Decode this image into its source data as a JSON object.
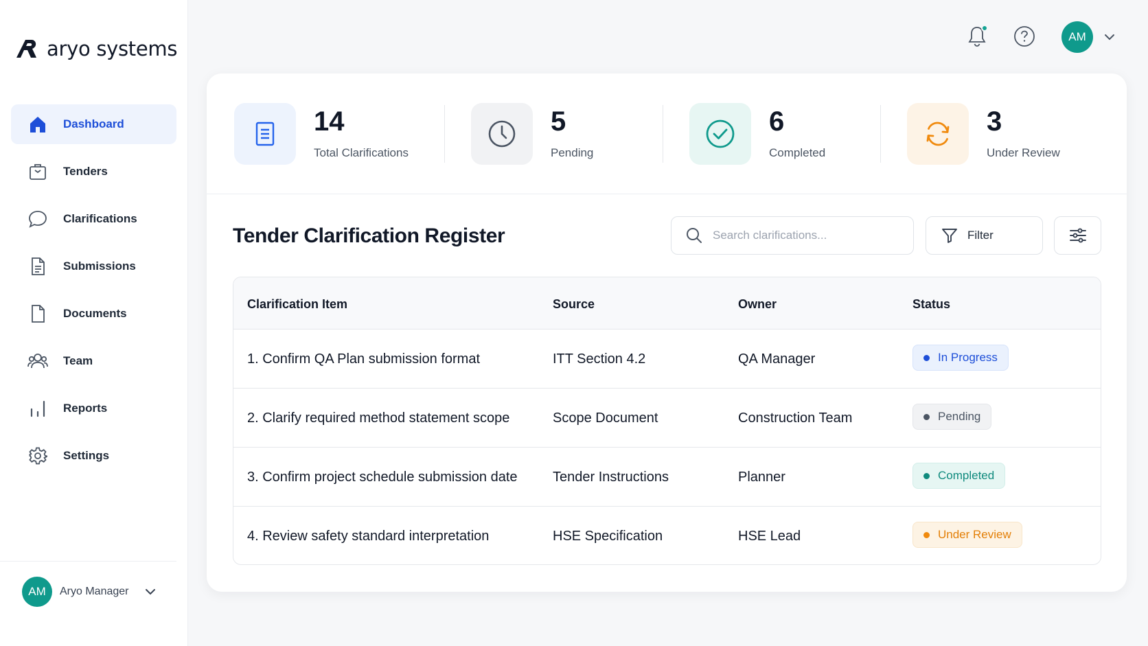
{
  "brand": {
    "name": "aryo systems"
  },
  "sidebar": {
    "items": [
      {
        "label": "Dashboard",
        "icon": "home-icon",
        "active": true
      },
      {
        "label": "Tenders",
        "icon": "briefcase-icon",
        "active": false
      },
      {
        "label": "Clarifications",
        "icon": "chat-bubble-icon",
        "active": false
      },
      {
        "label": "Submissions",
        "icon": "document-lines-icon",
        "active": false
      },
      {
        "label": "Documents",
        "icon": "file-icon",
        "active": false
      },
      {
        "label": "Team",
        "icon": "users-icon",
        "active": false
      },
      {
        "label": "Reports",
        "icon": "bar-chart-icon",
        "active": false
      },
      {
        "label": "Settings",
        "icon": "gear-icon",
        "active": false
      }
    ],
    "user": {
      "initials": "AM",
      "name": "Aryo Manager"
    }
  },
  "topbar": {
    "avatar_initials": "AM",
    "icons": [
      "bell-icon",
      "help-icon",
      "chevron-down-icon"
    ]
  },
  "stats": [
    {
      "value": "14",
      "label": "Total Clarifications",
      "icon": "document-list-icon",
      "bg": "#edf3fd",
      "color": "#2563eb"
    },
    {
      "value": "5",
      "label": "Pending",
      "icon": "clock-icon",
      "bg": "#f1f2f4",
      "color": "#4b5563"
    },
    {
      "value": "6",
      "label": "Completed",
      "icon": "check-circle-icon",
      "bg": "#e7f6f3",
      "color": "#0f9a8c"
    },
    {
      "value": "3",
      "label": "Under Review",
      "icon": "refresh-icon",
      "bg": "#fdf3e6",
      "color": "#f08a0e"
    }
  ],
  "register": {
    "title": "Tender Clarification Register",
    "search_placeholder": "Search clarifications...",
    "filter_label": "Filter",
    "columns": [
      "Clarification Item",
      "Source",
      "Owner",
      "Status"
    ],
    "rows": [
      {
        "item": "1. Confirm QA Plan submission format",
        "source": "ITT Section 4.2",
        "owner": "QA Manager",
        "status": "In Progress"
      },
      {
        "item": "2. Clarify required method statement scope",
        "source": "Scope Document",
        "owner": "Construction Team",
        "status": "Pending"
      },
      {
        "item": "3. Confirm project schedule submission date",
        "source": "Tender Instructions",
        "owner": "Planner",
        "status": "Completed"
      },
      {
        "item": "4. Review safety standard interpretation",
        "source": "HSE Specification",
        "owner": "HSE Lead",
        "status": "Under Review"
      }
    ]
  },
  "status_colors": {
    "In Progress": {
      "bg": "#eaf1fd",
      "border": "#d6e3fb",
      "text": "#1d4ed8",
      "dot": "#1d4ed8"
    },
    "Pending": {
      "bg": "#f1f2f4",
      "border": "#e4e6ea",
      "text": "#4b5563",
      "dot": "#4b5563"
    },
    "Completed": {
      "bg": "#e6f6f3",
      "border": "#d2eee9",
      "text": "#0f8a7d",
      "dot": "#0f8a7d"
    },
    "Under Review": {
      "bg": "#fdf3e4",
      "border": "#f8e6c9",
      "text": "#e37f07",
      "dot": "#f08a0e"
    }
  }
}
